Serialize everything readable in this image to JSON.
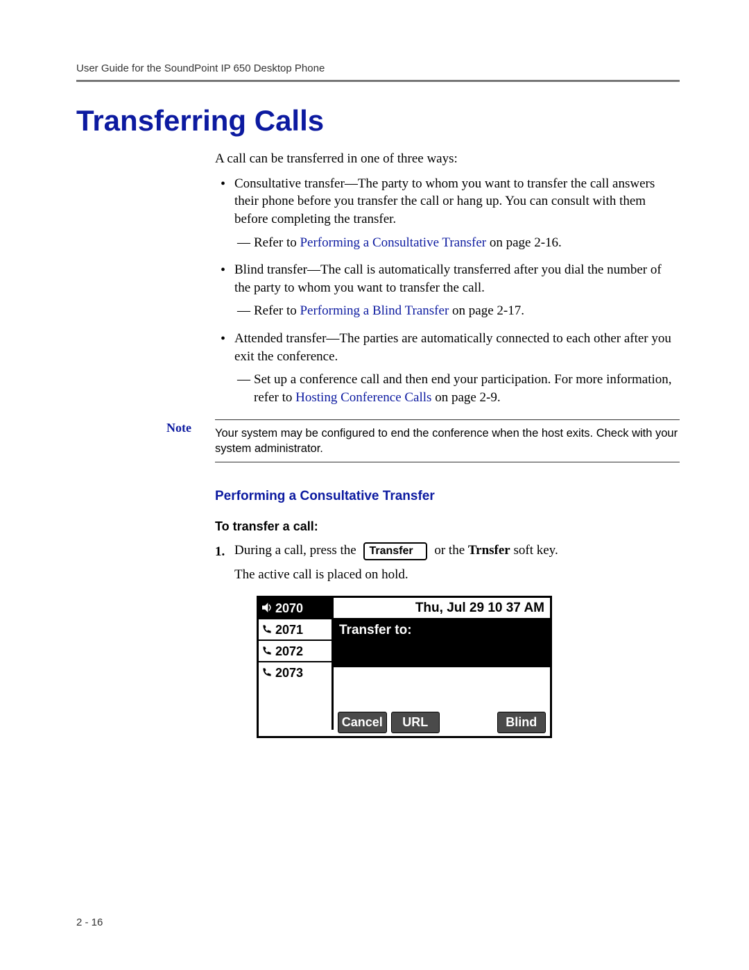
{
  "header": {
    "running_head": "User Guide for the SoundPoint IP 650 Desktop Phone"
  },
  "section": {
    "title": "Transferring Calls",
    "intro": "A call can be transferred in one of three ways:",
    "bullets": [
      {
        "text": "Consultative transfer—The party to whom you want to transfer the call answers their phone before you transfer the call or hang up. You can consult with them before completing the transfer.",
        "sub": {
          "prefix": "Refer to ",
          "link": "Performing a Consultative Transfer",
          "suffix": " on page 2-16."
        }
      },
      {
        "text": "Blind transfer—The call is automatically transferred after you dial the number of the party to whom you want to transfer the call.",
        "sub": {
          "prefix": "Refer to ",
          "link": "Performing a Blind Transfer",
          "suffix": " on page 2-17."
        }
      },
      {
        "text": "Attended transfer—The parties are automatically connected to each other after you exit the conference.",
        "sub": {
          "prefix": "Set up a conference call and then end your participation. For more information, refer to ",
          "link": "Hosting Conference Calls",
          "suffix": " on page 2-9."
        }
      }
    ]
  },
  "note": {
    "label": "Note",
    "body": "Your system may be configured to end the conference when the host exits. Check with your system administrator."
  },
  "subhead": "Performing a Consultative Transfer",
  "procedure": {
    "title": "To transfer a call:",
    "step1": {
      "num": "1.",
      "pre": "During a call, press the ",
      "key": "Transfer",
      "post_a": " or the ",
      "post_bold": "Trnsfer",
      "post_b": " soft key.",
      "line2": "The active call is placed on hold."
    }
  },
  "phone": {
    "lines": [
      "2070",
      "2071",
      "2072",
      "2073"
    ],
    "datetime": "Thu, Jul 29  10 37 AM",
    "prompt": "Transfer to:",
    "softkeys": [
      "Cancel",
      "URL",
      "",
      "Blind"
    ]
  },
  "footer": {
    "page": "2 - 16"
  }
}
